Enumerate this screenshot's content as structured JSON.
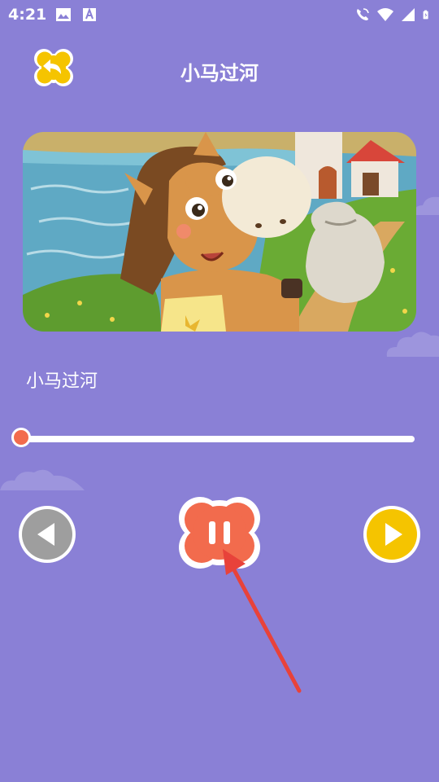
{
  "status_bar": {
    "time": "4:21",
    "icons": [
      "image-icon",
      "text-a-icon",
      "phone-wifi-icon",
      "wifi-icon",
      "signal-icon",
      "battery-icon"
    ]
  },
  "header": {
    "title": "小马过河",
    "back_icon": "back-arrow-icon"
  },
  "player": {
    "track_title": "小马过河",
    "progress": 0.0,
    "state": "playing",
    "buttons": {
      "previous_icon": "triangle-left-icon",
      "play_pause_icon": "pause-icon",
      "next_icon": "triangle-right-icon"
    }
  },
  "colors": {
    "background": "#8a80d6",
    "accent_orange": "#f26b4d",
    "accent_yellow": "#f5c400",
    "inactive_gray": "#9e9e9e",
    "annotation_red": "#e8423a"
  }
}
